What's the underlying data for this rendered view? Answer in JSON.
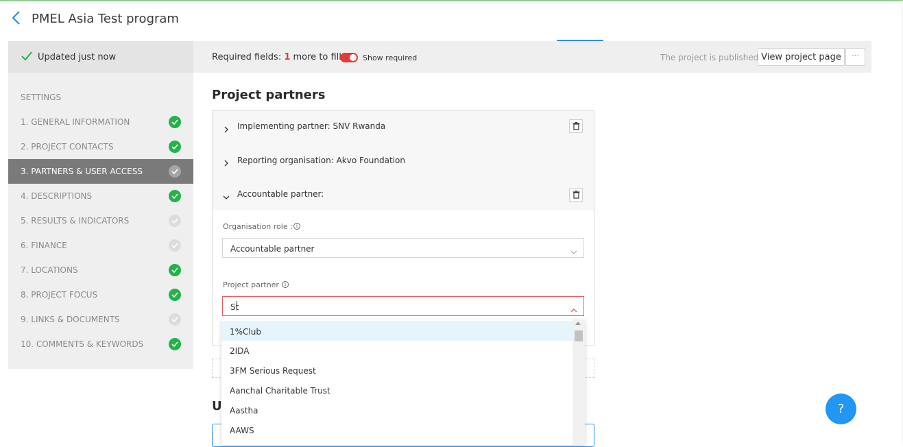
{
  "header": {
    "title": "PMEL Asia Test program"
  },
  "status": {
    "saved_text": "Updated just now"
  },
  "toolbar": {
    "required_prefix": "Required fields: ",
    "required_count": "1",
    "required_suffix": " more to fill",
    "show_required_label": "Show required",
    "published_text": "The project is published",
    "view_button_label": "View project page",
    "more_label": "···"
  },
  "sidebar": {
    "settings_label": "SETTINGS",
    "items": [
      {
        "label": "1. GENERAL INFORMATION",
        "status": "complete"
      },
      {
        "label": "2. PROJECT CONTACTS",
        "status": "complete"
      },
      {
        "label": "3. PARTNERS & USER ACCESS",
        "status": "active"
      },
      {
        "label": "4. DESCRIPTIONS",
        "status": "complete"
      },
      {
        "label": "5. RESULTS & INDICATORS",
        "status": "incomplete"
      },
      {
        "label": "6. FINANCE",
        "status": "incomplete"
      },
      {
        "label": "7. LOCATIONS",
        "status": "complete"
      },
      {
        "label": "8. PROJECT FOCUS",
        "status": "complete"
      },
      {
        "label": "9. LINKS & DOCUMENTS",
        "status": "incomplete"
      },
      {
        "label": "10. COMMENTS & KEYWORDS",
        "status": "complete"
      }
    ]
  },
  "main": {
    "section_title": "Project partners",
    "partners": [
      {
        "label": "Implementing partner: SNV Rwanda"
      },
      {
        "label": "Reporting organisation: Akvo Foundation"
      },
      {
        "label": "Accountable partner:"
      }
    ],
    "org_role_label": "Organisation role :",
    "org_role_value": "Accountable partner",
    "project_partner_label": "Project partner",
    "project_partner_value": "St",
    "users_title_partial": "U:"
  },
  "dropdown": {
    "options": [
      "1%Club",
      "2IDA",
      "3FM Serious Request",
      "Aanchal Charitable Trust",
      "Aastha",
      "AAWS"
    ]
  },
  "help": {
    "label": "?"
  },
  "colors": {
    "accent": "#2196f3",
    "success": "#24b24a",
    "required": "#e53935"
  }
}
